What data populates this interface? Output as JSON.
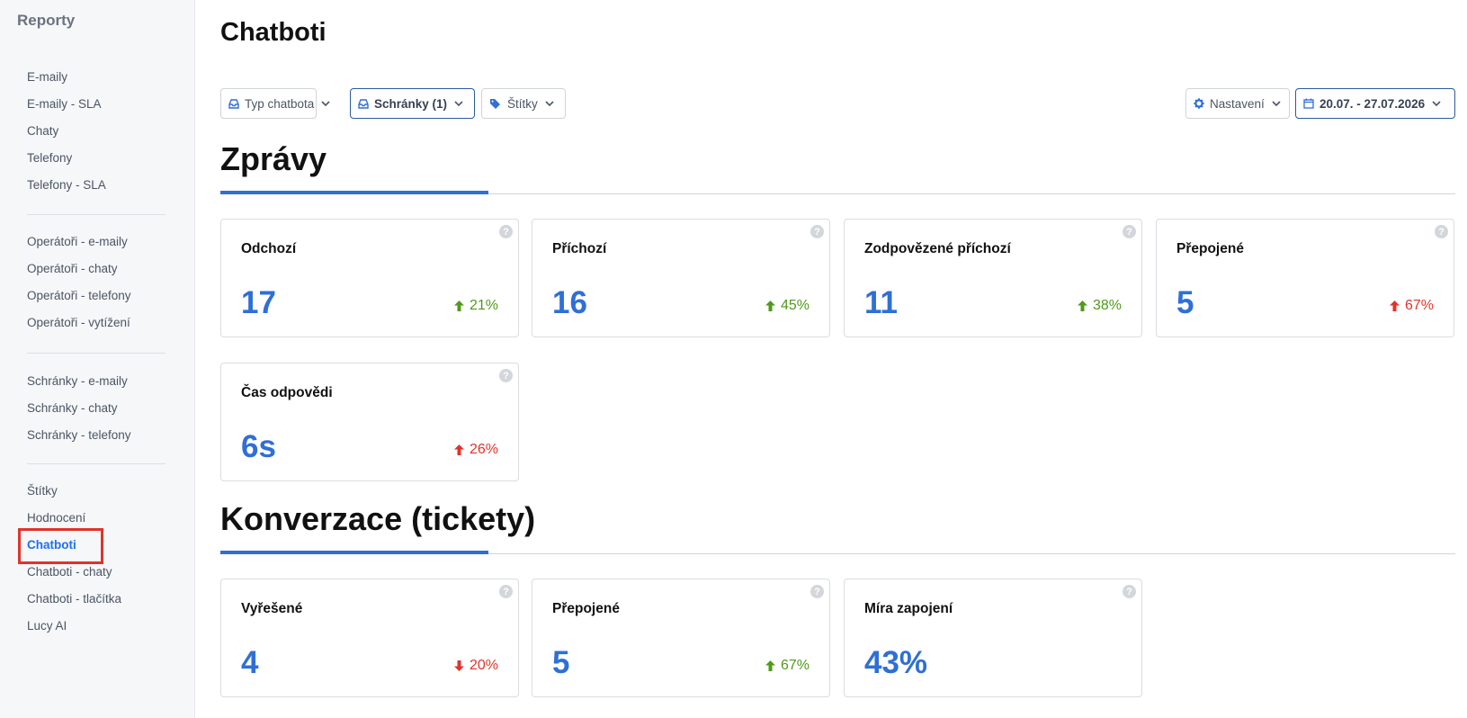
{
  "sidebar": {
    "title": "Reporty",
    "groups": [
      [
        "E-maily",
        "E-maily - SLA",
        "Chaty",
        "Telefony",
        "Telefony - SLA"
      ],
      [
        "Operátoři - e-maily",
        "Operátoři - chaty",
        "Operátoři - telefony",
        "Operátoři - vytížení"
      ],
      [
        "Schránky - e-maily",
        "Schránky - chaty",
        "Schránky - telefony"
      ],
      [
        "Štítky",
        "Hodnocení",
        "Chatboti",
        "Chatboti - chaty",
        "Chatboti - tlačítka",
        "Lucy AI"
      ]
    ],
    "active_item": "Chatboti"
  },
  "page": {
    "title": "Chatboti"
  },
  "filters": {
    "bot_type": "Typ chatbota",
    "inboxes": "Schránky (1)",
    "tags": "Štítky",
    "settings": "Nastavení",
    "date_range": "20.07. - 27.07.2026"
  },
  "sections": {
    "messages": {
      "title": "Zprávy",
      "cards": [
        {
          "title": "Odchozí",
          "value": "17",
          "change": "21%",
          "direction": "up",
          "tone": "good"
        },
        {
          "title": "Příchozí",
          "value": "16",
          "change": "45%",
          "direction": "up",
          "tone": "good"
        },
        {
          "title": "Zodpovězené příchozí",
          "value": "11",
          "change": "38%",
          "direction": "up",
          "tone": "good"
        },
        {
          "title": "Přepojené",
          "value": "5",
          "change": "67%",
          "direction": "up",
          "tone": "bad"
        },
        {
          "title": "Čas odpovědi",
          "value": "6s",
          "change": "26%",
          "direction": "up",
          "tone": "bad"
        }
      ]
    },
    "conversations": {
      "title": "Konverzace (tickety)",
      "cards": [
        {
          "title": "Vyřešené",
          "value": "4",
          "change": "20%",
          "direction": "down",
          "tone": "bad"
        },
        {
          "title": "Přepojené",
          "value": "5",
          "change": "67%",
          "direction": "up",
          "tone": "good"
        },
        {
          "title": "Míra zapojení",
          "value": "43%",
          "change": "",
          "direction": "",
          "tone": ""
        }
      ]
    }
  },
  "help_glyph": "?",
  "colors": {
    "accent": "#2f6fd6",
    "good": "#4f9a1a",
    "bad": "#e0342b",
    "active_outline": "#e0342b"
  }
}
